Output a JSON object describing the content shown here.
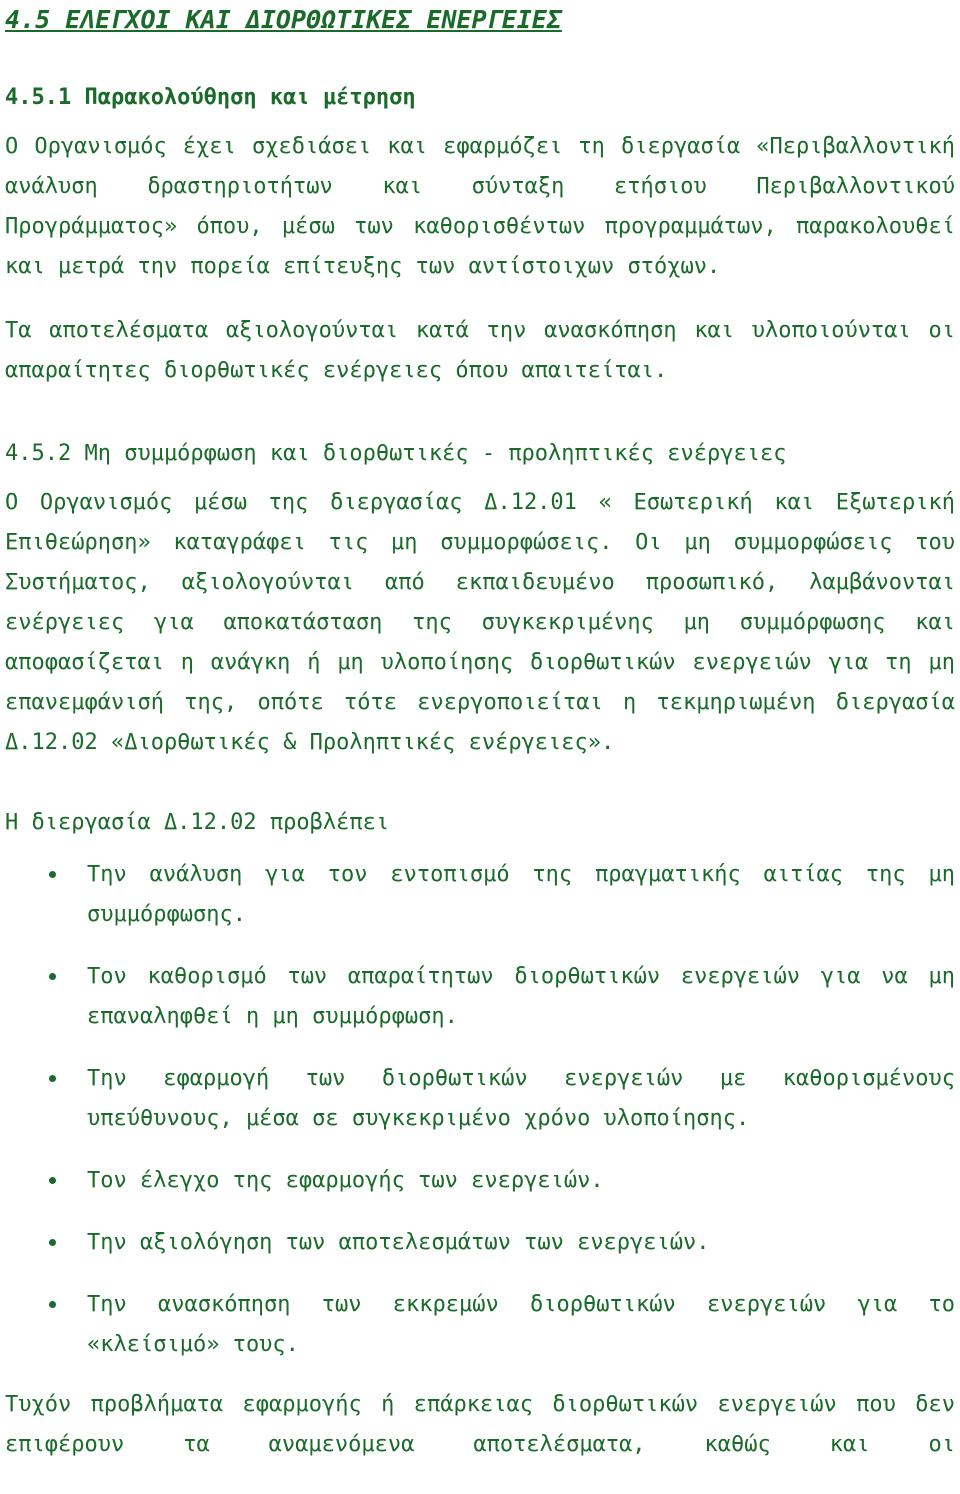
{
  "document": {
    "language": "Greek",
    "text_color": "#1a6b2a",
    "background_color": "#ffffff",
    "section_heading": "4.5 ΕΛΕΓΧΟΙ ΚΑΙ ΔΙΟΡΘΩΤΙΚΕΣ ΕΝΕΡΓΕΙΕΣ",
    "subsection_1": {
      "heading": "4.5.1 Παρακολούθηση και μέτρηση",
      "paragraph_1": "Ο Οργανισμός έχει σχεδιάσει και εφαρμόζει τη διεργασία «Περιβαλλοντική ανάλυση δραστηριοτήτων και σύνταξη ετήσιου Περιβαλλοντικού Προγράμματος» όπου, μέσω των καθορισθέντων προγραμμάτων, παρακολουθεί και μετρά την πορεία επίτευξης των αντίστοιχων στόχων.",
      "paragraph_2": "Τα αποτελέσματα αξιολογούνται κατά την ανασκόπηση και υλοποιούνται οι απαραίτητες διορθωτικές ενέργειες όπου απαιτείται."
    },
    "subsection_2": {
      "heading": "4.5.2 Μη συμμόρφωση και διορθωτικές - προληπτικές ενέργειες",
      "paragraph_1": "Ο Οργανισμός μέσω της διεργασίας Δ.12.01 « Εσωτερική και Εξωτερική Επιθεώρηση» καταγράφει τις μη συμμορφώσεις. Οι μη συμμορφώσεις του Συστήματος, αξιολογούνται από εκπαιδευμένο προσωπικό, λαμβάνονται ενέργειες για αποκατάσταση της συγκεκριμένης μη συμμόρφωσης και αποφασίζεται η ανάγκη ή μη υλοποίησης διορθωτικών ενεργειών για τη μη επανεμφάνισή της, οπότε τότε ενεργοποιείται η τεκμηριωμένη διεργασία Δ.12.02 «Διορθωτικές & Προληπτικές ενέργειες».",
      "list_intro": "Η διεργασία Δ.12.02 προβλέπει",
      "bullets": [
        "Την ανάλυση για τον εντοπισμό της πραγματικής αιτίας της μη συμμόρφωσης.",
        "Τον καθορισμό των απαραίτητων διορθωτικών ενεργειών για να μη επαναληφθεί η μη συμμόρφωση.",
        "Την εφαρμογή των διορθωτικών ενεργειών με καθορισμένους υπεύθυνους, μέσα σε συγκεκριμένο χρόνο υλοποίησης.",
        "Τον έλεγχο της εφαρμογής των ενεργειών.",
        "Την αξιολόγηση των αποτελεσμάτων των ενεργειών.",
        "Την ανασκόπηση των εκκρεμών διορθωτικών ενεργειών για το «κλείσιμό» τους."
      ],
      "closing_paragraph": "Τυχόν προβλήματα εφαρμογής ή επάρκειας διορθωτικών ενεργειών που δεν επιφέρουν τα αναμενόμενα αποτελέσματα, καθώς και οι"
    }
  }
}
